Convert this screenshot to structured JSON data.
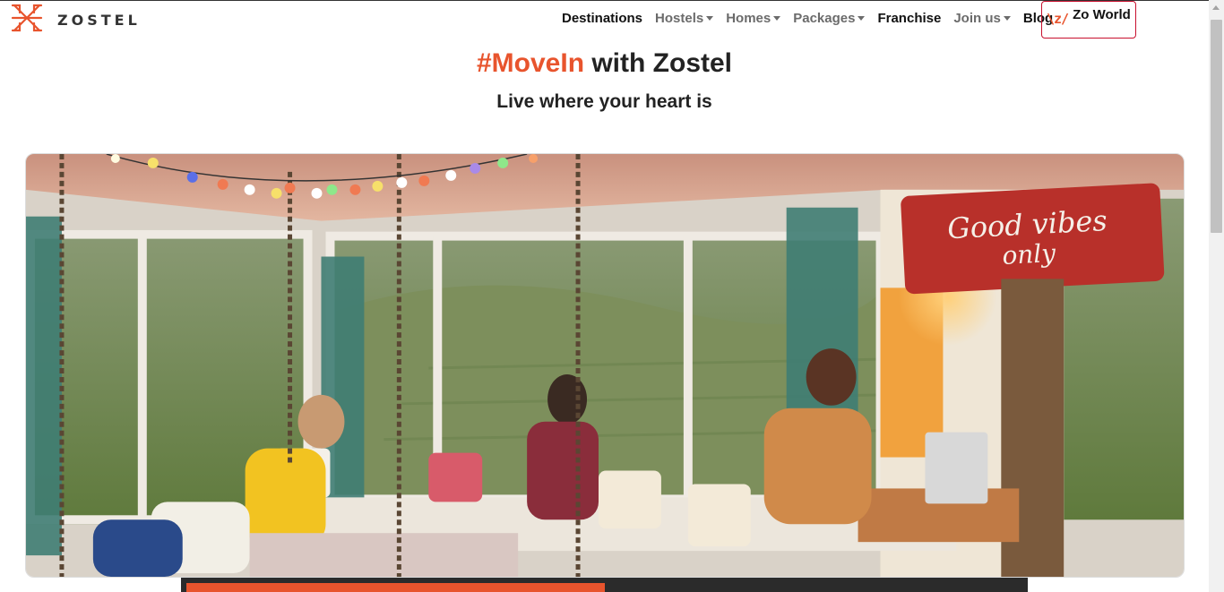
{
  "brand": {
    "name": "ZOSTEL",
    "logo_icon": "zostel-logo-icon",
    "accent": "#e8542d"
  },
  "nav": {
    "items": [
      {
        "label": "Destinations",
        "dropdown": false,
        "emphasis": true
      },
      {
        "label": "Hostels",
        "dropdown": true,
        "emphasis": false
      },
      {
        "label": "Homes",
        "dropdown": true,
        "emphasis": false
      },
      {
        "label": "Packages",
        "dropdown": true,
        "emphasis": false
      },
      {
        "label": "Franchise",
        "dropdown": false,
        "emphasis": true
      },
      {
        "label": "Join us",
        "dropdown": true,
        "emphasis": false
      },
      {
        "label": "Blog",
        "dropdown": false,
        "emphasis": true
      }
    ],
    "zo_world": {
      "mark": "\\z/",
      "label": "Zo World",
      "border_color": "#c8102e"
    }
  },
  "hero": {
    "headline_tag": "#MoveIn",
    "headline_rest": " with Zostel",
    "subheadline": "Live where your heart is",
    "sign_text_line1": "Good vibes",
    "sign_text_line2": "only"
  },
  "progress": {
    "fraction": 0.5
  }
}
